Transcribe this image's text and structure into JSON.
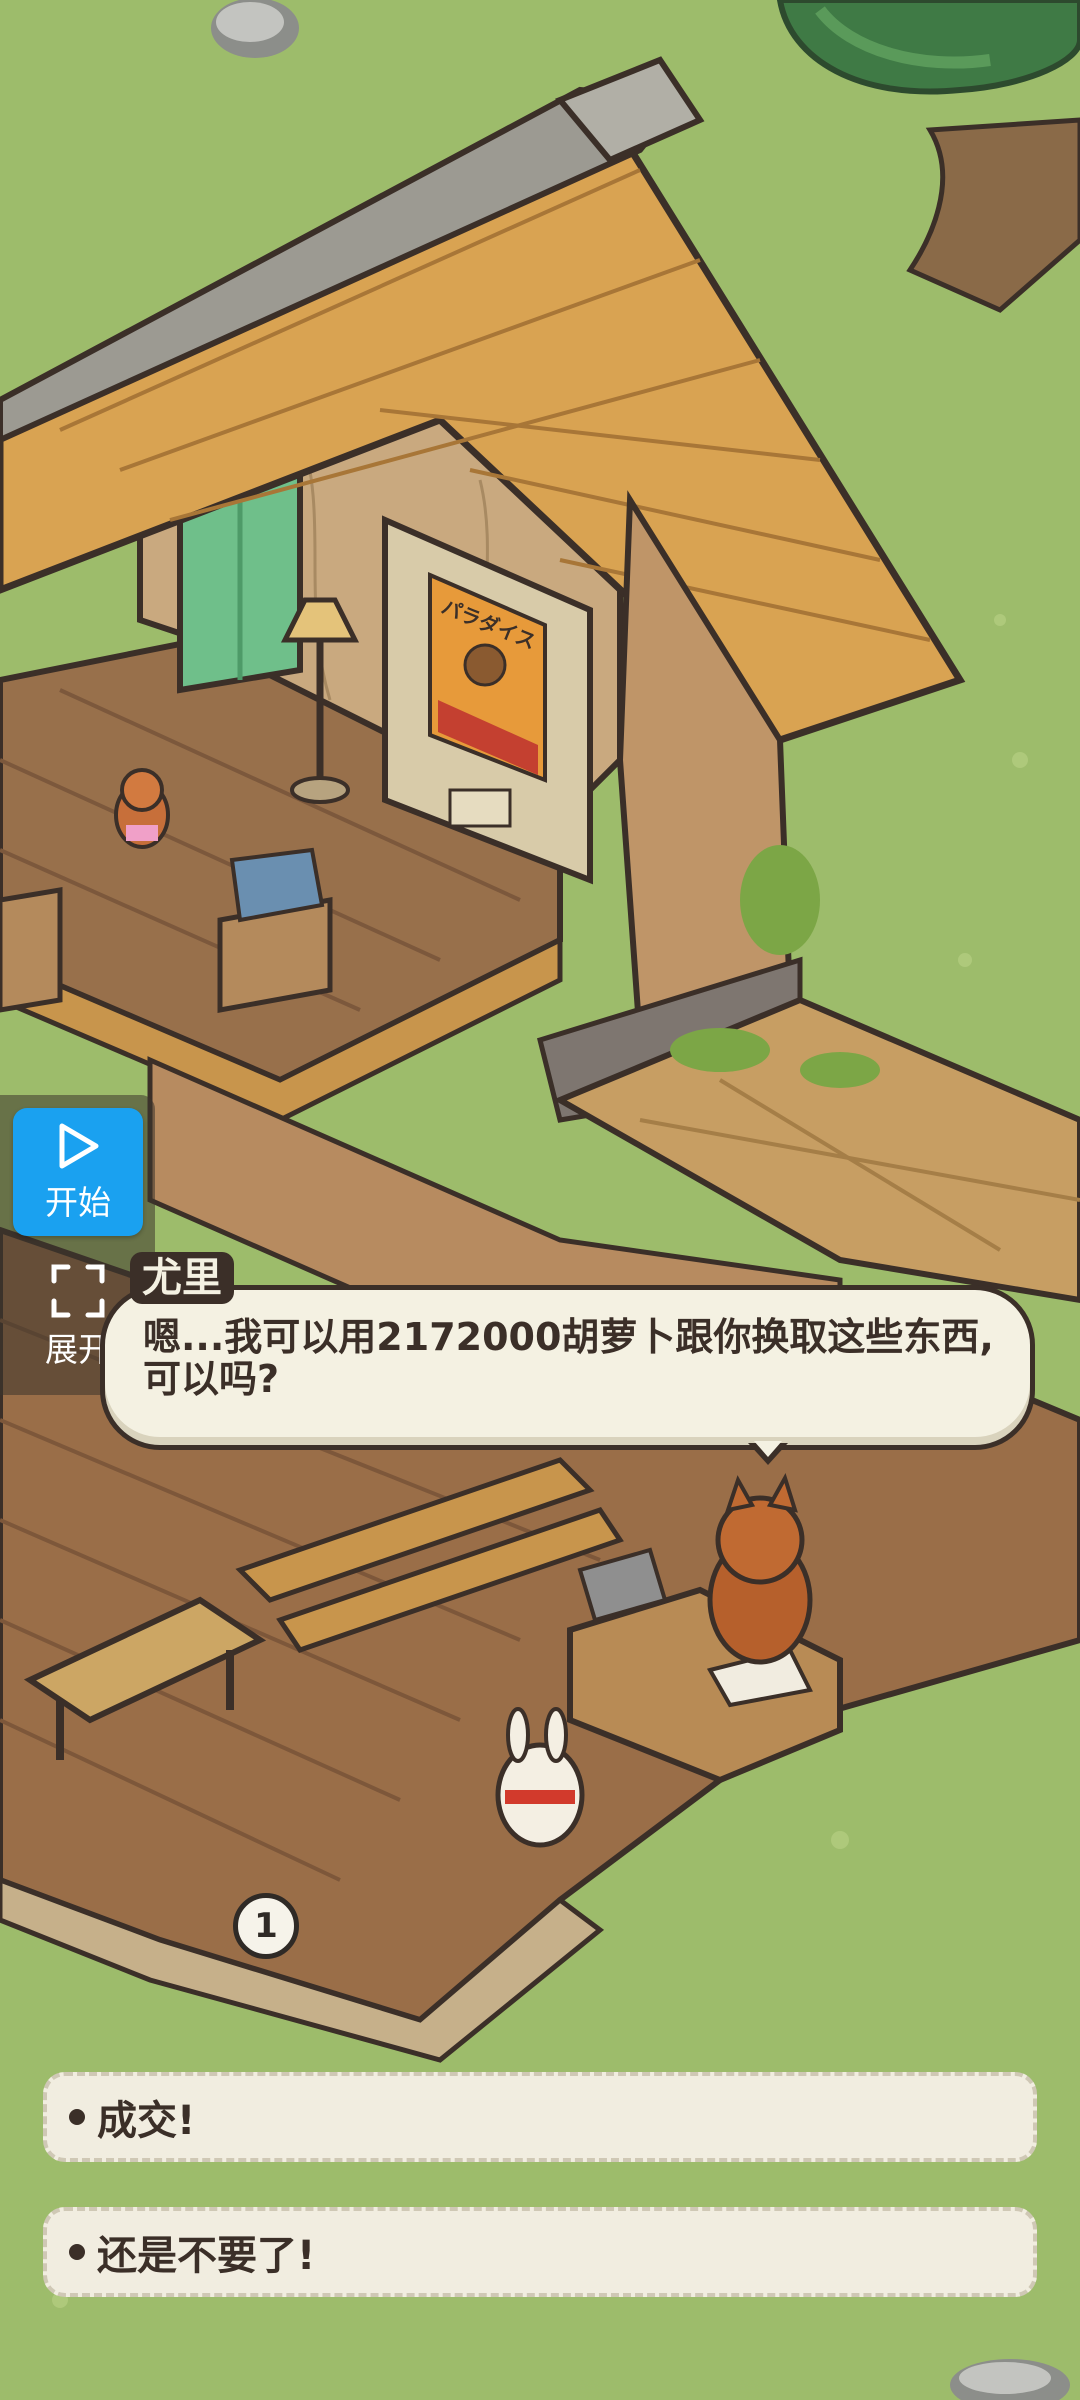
{
  "overlay": {
    "start_label": "开始",
    "expand_label": "展开"
  },
  "dialog": {
    "speaker": "尤里",
    "line1": "嗯...我可以用2172000胡萝卜跟你换取这些东西,",
    "line2": "可以吗?"
  },
  "choices": [
    {
      "label": "成交!"
    },
    {
      "label": "还是不要了!"
    }
  ],
  "marker": {
    "number": "1"
  },
  "poster": {
    "title": "パラダイス"
  },
  "colors": {
    "grass": "#9dbc6b",
    "roof": "#d9a352",
    "wood": "#a7784f",
    "accent_blue": "#1aa1f0",
    "dialog_bg": "#f4f1e2",
    "ink": "#3b2f28"
  },
  "icons": {
    "start": "play-icon",
    "expand": "expand-icon"
  }
}
